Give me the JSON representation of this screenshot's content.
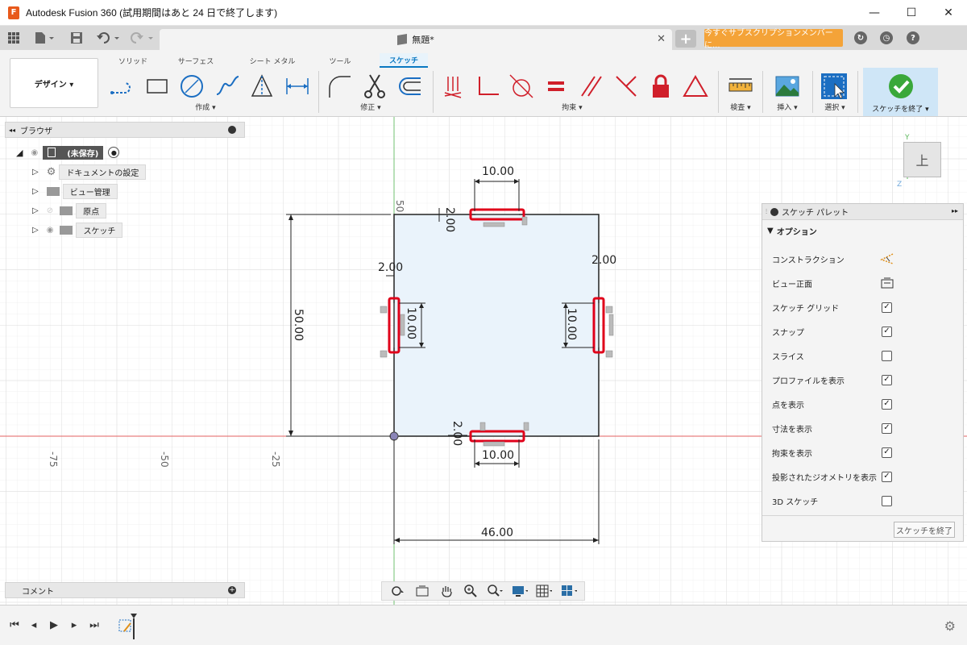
{
  "window": {
    "title": "Autodesk Fusion 360 (試用期間はあと 24 日で終了します)",
    "app_logo": "F",
    "minimize": "—",
    "maximize": "☐",
    "close": "✕"
  },
  "tabbar": {
    "doc_title": "無題*",
    "tab_close": "✕",
    "new_tab": "+",
    "subscribe": "今すぐサブスクリプションメンバーに..."
  },
  "ribbon": {
    "design": "デザイン ▾",
    "tabs": [
      "ソリッド",
      "サーフェス",
      "シート メタル",
      "ツール",
      "スケッチ"
    ],
    "active_tab": "スケッチ",
    "groups": {
      "create": "作成 ▾",
      "modify": "修正 ▾",
      "constraints": "拘束 ▾",
      "inspect": "検査 ▾",
      "insert": "挿入 ▾",
      "select": "選択 ▾",
      "finish": "スケッチを終了 ▾"
    }
  },
  "browser": {
    "title": "ブラウザ",
    "root": "(未保存)",
    "items": [
      "ドキュメントの設定",
      "ビュー管理",
      "原点",
      "スケッチ"
    ]
  },
  "comment": {
    "title": "コメント"
  },
  "sketch": {
    "axis_labels": [
      "-75",
      "-50",
      "-25"
    ],
    "y_axis_label": "50",
    "dimensions": {
      "top_width": "10.00",
      "top_offset": "2.00",
      "left_height": "10.00",
      "left_offset": "2.00",
      "right_height": "10.00",
      "right_offset": "2.00",
      "bottom_offset": "2.00",
      "bottom_width": "10.00",
      "height": "50.00",
      "width": "46.00"
    },
    "highlight_color": "#e0001a"
  },
  "viewcube": {
    "face": "上",
    "y_label": "Y",
    "z_label": "Z"
  },
  "palette": {
    "title": "スケッチ パレット",
    "section": "オプション",
    "rows": [
      {
        "label": "コンストラクション",
        "icon": "construction-icon"
      },
      {
        "label": "ビュー正面",
        "icon": "look-at-icon"
      },
      {
        "label": "スケッチ グリッド",
        "checked": true
      },
      {
        "label": "スナップ",
        "checked": true
      },
      {
        "label": "スライス",
        "checked": false
      },
      {
        "label": "プロファイルを表示",
        "checked": true
      },
      {
        "label": "点を表示",
        "checked": true
      },
      {
        "label": "寸法を表示",
        "checked": true
      },
      {
        "label": "拘束を表示",
        "checked": true
      },
      {
        "label": "投影されたジオメトリを表示",
        "checked": true
      },
      {
        "label": "3D スケッチ",
        "checked": false
      }
    ],
    "check_mark": "✓",
    "finish": "スケッチを終了"
  }
}
